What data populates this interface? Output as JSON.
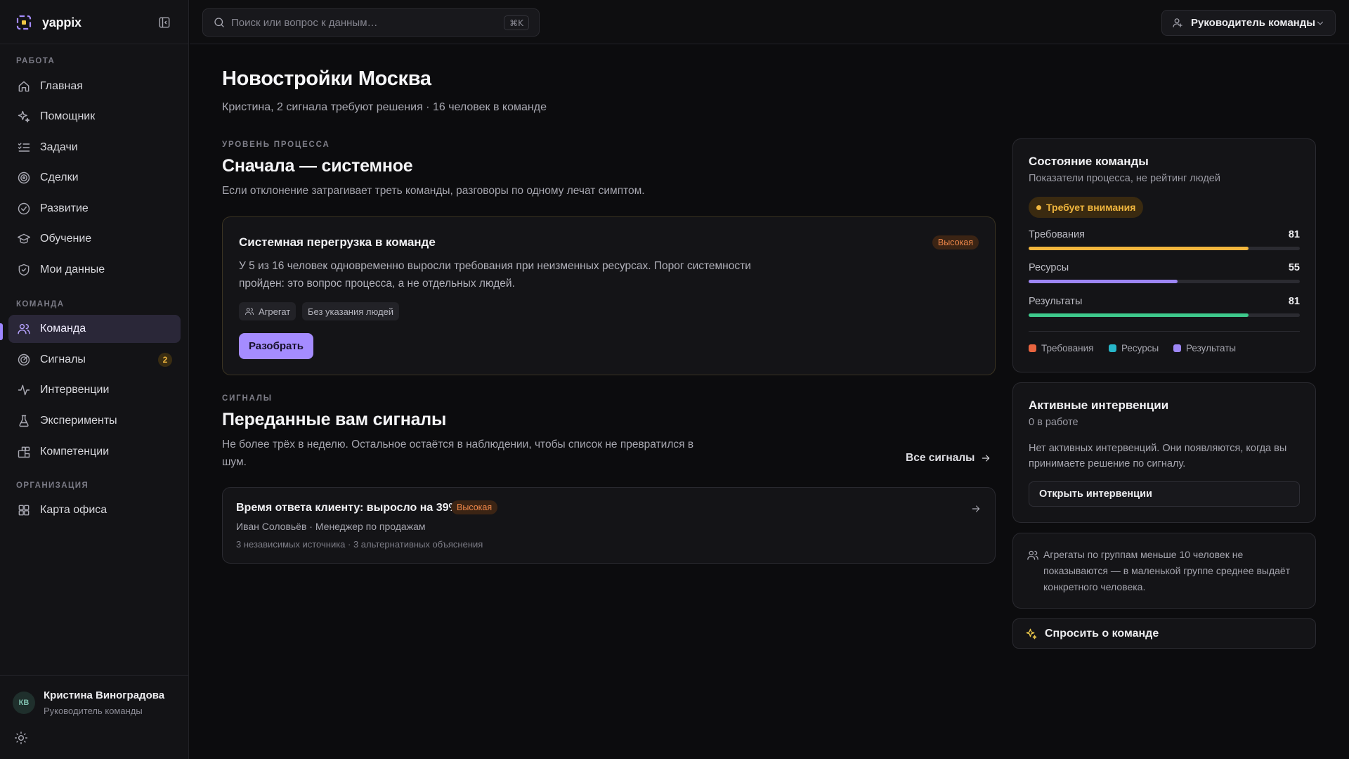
{
  "app": {
    "brand": "yappix"
  },
  "search": {
    "placeholder": "Поиск или вопрос к данным…",
    "shortcut": "⌘K"
  },
  "role_switcher": {
    "label": "Руководитель команды"
  },
  "sidebar": {
    "sections": [
      {
        "label": "РАБОТА"
      },
      {
        "label": "КОМАНДА"
      },
      {
        "label": "ОРГАНИЗАЦИЯ"
      }
    ],
    "items": [
      {
        "label": "Главная",
        "icon": "home-icon"
      },
      {
        "label": "Помощник",
        "icon": "sparkles-icon"
      },
      {
        "label": "Задачи",
        "icon": "list-checks-icon"
      },
      {
        "label": "Сделки",
        "icon": "target-icon"
      },
      {
        "label": "Развитие",
        "icon": "circle-check-icon"
      },
      {
        "label": "Обучение",
        "icon": "graduation-cap-icon"
      },
      {
        "label": "Мои данные",
        "icon": "shield-icon"
      },
      {
        "label": "Команда",
        "icon": "users-icon",
        "active": true
      },
      {
        "label": "Сигналы",
        "icon": "radar-icon",
        "badge": "2"
      },
      {
        "label": "Интервенции",
        "icon": "activity-icon"
      },
      {
        "label": "Эксперименты",
        "icon": "flask-icon"
      },
      {
        "label": "Компетенции",
        "icon": "blocks-icon"
      },
      {
        "label": "Карта офиса",
        "icon": "grid-icon"
      }
    ],
    "user": {
      "initials": "КВ",
      "name": "Кристина Виноградова",
      "role": "Руководитель команды"
    }
  },
  "main": {
    "title": "Новостройки Москва",
    "subtitle": "Кристина, 2 сигнала требуют решения · 16 человек в команде",
    "process": {
      "eyebrow": "УРОВЕНЬ ПРОЦЕССА",
      "heading": "Сначала — системное",
      "lead": "Если отклонение затрагивает треть команды, разговоры по одному лечат симптом.",
      "card": {
        "title": "Системная перегрузка в команде",
        "severity": "Высокая",
        "description": "У 5 из 16 человек одновременно выросли требования при неизменных ресурсах. Порог системности пройден: это вопрос процесса, а не отдельных людей.",
        "chips": [
          "Агрегат",
          "Без указания людей"
        ],
        "action": "Разобрать"
      }
    },
    "signals": {
      "eyebrow": "СИГНАЛЫ",
      "heading": "Переданные вам сигналы",
      "lead": "Не более трёх в неделю. Остальное остаётся в наблюдении, чтобы список не превратился в шум.",
      "all_link": "Все сигналы",
      "items": [
        {
          "title": "Время ответа клиенту: выросло на 39%",
          "severity": "Высокая",
          "person": "Иван Соловьёв · Менеджер по продажам",
          "meta": "3 независимых источника · 3 альтернативных объяснения"
        }
      ]
    }
  },
  "right": {
    "team_state": {
      "title": "Состояние команды",
      "subtitle": "Показатели процесса, не рейтинг людей",
      "status": "Требует внимания",
      "metrics": [
        {
          "label": "Требования",
          "value": 81,
          "color": "#f2b63d"
        },
        {
          "label": "Ресурсы",
          "value": 55,
          "color": "#9d86f5"
        },
        {
          "label": "Результаты",
          "value": 81,
          "color": "#3ec98c"
        }
      ],
      "legend": [
        {
          "label": "Требования",
          "color": "#e8643f"
        },
        {
          "label": "Ресурсы",
          "color": "#27b6c9"
        },
        {
          "label": "Результаты",
          "color": "#9d86f5"
        }
      ]
    },
    "interventions": {
      "title": "Активные интервенции",
      "count": "0 в работе",
      "empty": "Нет активных интервенций. Они появляются, когда вы принимаете решение по сигналу.",
      "button": "Открыть интервенции"
    },
    "privacy_note": "Агрегаты по группам меньше 10 человек не показываются — в маленькой группе среднее выдаёт конкретного человека.",
    "ask_button": "Спросить о команде"
  }
}
